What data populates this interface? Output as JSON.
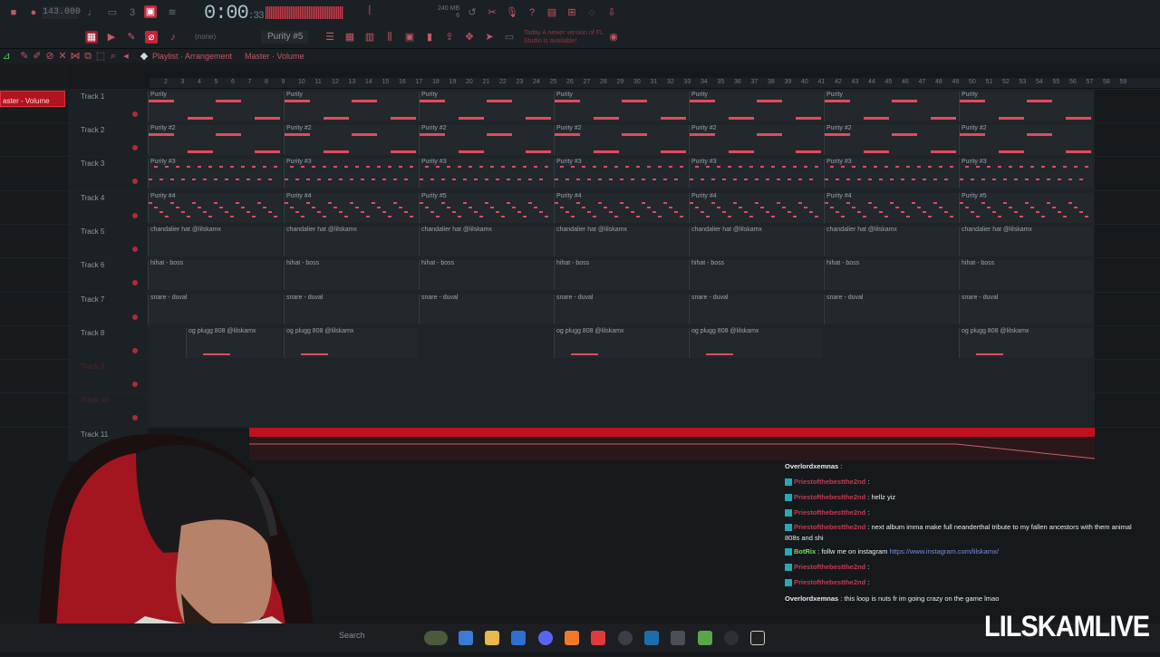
{
  "toolbar": {
    "bpm": "143.000",
    "time_main": "0:00",
    "time_sub": "33",
    "pattern": "Purity #5",
    "none_label": "(none)",
    "memory_line1": "240 MB",
    "memory_line2": "6",
    "update_notice": "Today  A newer version of FL Studio is available!"
  },
  "breadcrumb": {
    "part1": "Playlist · Arrangement",
    "part2": "Master · Volume"
  },
  "left_panel": {
    "selected_label": "aster - Volume"
  },
  "ruler": {
    "bars": [
      "2",
      "3",
      "4",
      "5",
      "6",
      "7",
      "8",
      "9",
      "10",
      "11",
      "12",
      "13",
      "14",
      "15",
      "16",
      "17",
      "18",
      "19",
      "20",
      "21",
      "22",
      "23",
      "24",
      "25",
      "26",
      "27",
      "28",
      "29",
      "30",
      "31",
      "32",
      "33",
      "34",
      "35",
      "36",
      "37",
      "38",
      "39",
      "40",
      "41",
      "42",
      "43",
      "44",
      "45",
      "46",
      "47",
      "48",
      "49",
      "50",
      "51",
      "52",
      "53",
      "54",
      "55",
      "56",
      "57",
      "58",
      "59"
    ]
  },
  "tracks": [
    {
      "name": "Track 1",
      "clip": "Purity"
    },
    {
      "name": "Track 2",
      "clip": "Purity #2"
    },
    {
      "name": "Track 3",
      "clip": "Purity #3"
    },
    {
      "name": "Track 4",
      "clip": "Purity #4",
      "alt_clip": "Purity #5"
    },
    {
      "name": "Track 5",
      "clip": "chandalier hat @lilskamx"
    },
    {
      "name": "Track 6",
      "clip": "hihat - boss"
    },
    {
      "name": "Track 7",
      "clip": "snare - duval"
    },
    {
      "name": "Track 8",
      "clip": "og plugg 808 @lilskamx"
    },
    {
      "name": "Track 9",
      "clip": ""
    },
    {
      "name": "Track 10",
      "clip": ""
    },
    {
      "name": "Track 11",
      "clip": ""
    }
  ],
  "chat": [
    {
      "user": "Overlordxemnas",
      "msg": ""
    },
    {
      "user": "Priestofthebestthe2nd",
      "msg": ""
    },
    {
      "user": "Priestofthebestthe2nd",
      "msg": "hellz yiz"
    },
    {
      "user": "Priestofthebestthe2nd",
      "msg": ""
    },
    {
      "user": "Priestofthebestthe2nd",
      "msg": "next album imma make full neanderthal tribute to my fallen ancestors with them animal"
    },
    {
      "user": "",
      "msg": "808s and shi"
    },
    {
      "user": "BotRix",
      "msg": "follw me on instagram",
      "link": "https://www.instagram.com/lilskamx/"
    },
    {
      "user": "Priestofthebestthe2nd",
      "msg": ""
    },
    {
      "user": "Priestofthebestthe2nd",
      "msg": ""
    },
    {
      "user": "Overlordxemnas",
      "msg": "this loop is nuts fr im going crazy on the game lmao"
    }
  ],
  "taskbar": {
    "search_label": "Search"
  },
  "overlay": {
    "brand": "LILSKAMLIVE"
  },
  "colors": {
    "accent": "#e24a5e",
    "automation": "#c1101f",
    "background": "#15191c"
  }
}
